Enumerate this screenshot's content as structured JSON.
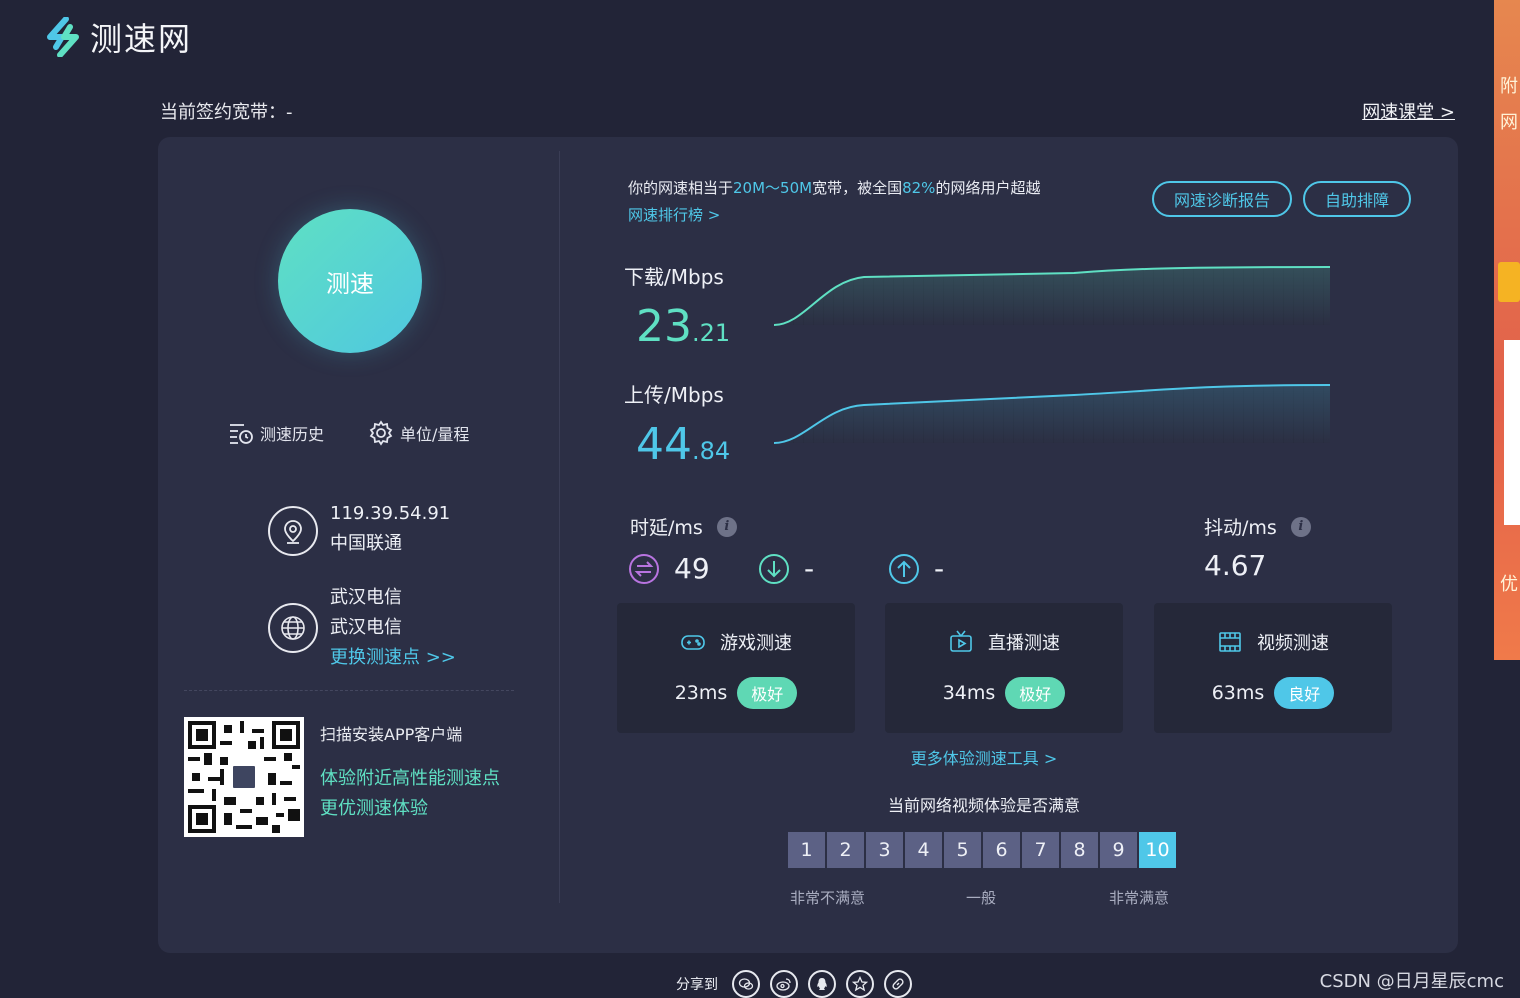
{
  "app": {
    "logo_text": "测速网"
  },
  "header": {
    "bandwidth_label": "当前签约宽带：-",
    "course_link": "网速课堂 >"
  },
  "side_ad": {
    "text1": "附",
    "text2": "网",
    "text3": "优"
  },
  "left": {
    "speed_button": "测速",
    "history_label": "测速历史",
    "unit_label": "单位/量程",
    "ip": "119.39.54.91",
    "isp": "中国联通",
    "node_city": "武汉电信",
    "node_name": "武汉电信",
    "change_node": "更换测速点 >>",
    "qr_title": "扫描安装APP客户端",
    "qr_line1": "体验附近高性能测速点",
    "qr_line2": "更优测速体验"
  },
  "summary": {
    "prefix": "你的网速相当于",
    "bandwidth": "20M～50M",
    "middle": "宽带，被全国",
    "percent": "82%",
    "suffix": "的网络用户超越",
    "rank_link": "网速排行榜 >",
    "report_button": "网速诊断报告",
    "troubleshoot_button": "自助排障"
  },
  "download": {
    "label": "下载/Mbps",
    "int": "23",
    "dec": ".21",
    "color": "#5fe0c3"
  },
  "upload": {
    "label": "上传/Mbps",
    "int": "44",
    "dec": ".84",
    "color": "#4fc7e8"
  },
  "latency": {
    "label": "时延/ms",
    "idle": "49",
    "down": "-",
    "up": "-"
  },
  "jitter": {
    "label": "抖动/ms",
    "value": "4.67"
  },
  "experience": [
    {
      "title": "游戏测速",
      "value": "23ms",
      "grade": "极好"
    },
    {
      "title": "直播测速",
      "value": "34ms",
      "grade": "极好"
    },
    {
      "title": "视频测速",
      "value": "63ms",
      "grade": "良好"
    }
  ],
  "more_tools": "更多体验测速工具 >",
  "survey": {
    "question": "当前网络视频体验是否满意",
    "options": [
      "1",
      "2",
      "3",
      "4",
      "5",
      "6",
      "7",
      "8",
      "9",
      "10"
    ],
    "selected": "10",
    "low": "非常不满意",
    "mid": "一般",
    "high": "非常满意"
  },
  "share": {
    "label": "分享到"
  },
  "watermark": "CSDN @日月星辰cmc"
}
